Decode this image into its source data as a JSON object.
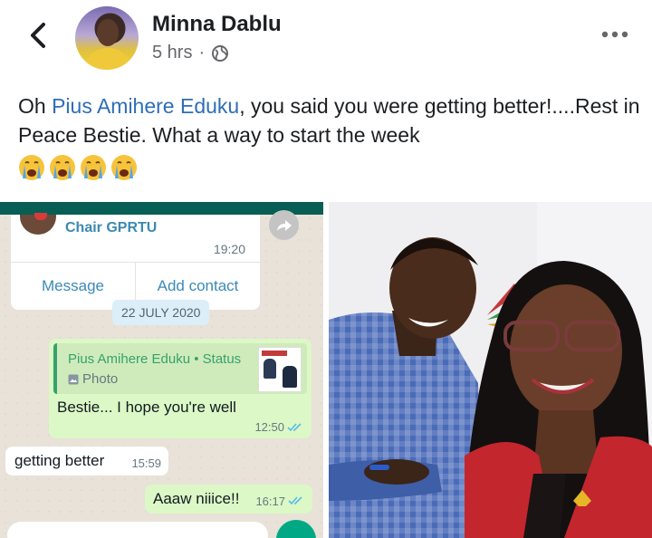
{
  "post": {
    "author": "Minna Dablu",
    "time": "5 hrs",
    "separator": "·",
    "caption_before": "Oh ",
    "mention": "Pius Amihere Eduku",
    "caption_after": ", you said you were getting better!....Rest in Peace Bestie. What a way to start the week",
    "emoji_count": 4,
    "emoji_name": "loudly-crying-face"
  },
  "chat": {
    "contact_name": "Chair GPRTU",
    "contact_time": "19:20",
    "message_button": "Message",
    "add_contact_button": "Add contact",
    "date": "22 JULY 2020",
    "messages": [
      {
        "quote_title": "Pius Amihere Eduku • Status",
        "quote_sub": "Photo",
        "text": "Bestie... I hope you're well",
        "time": "12:50"
      },
      {
        "text": "getting better",
        "time": "15:59"
      },
      {
        "text": "Aaaw niiice!!",
        "time": "16:17"
      }
    ]
  },
  "colors": {
    "mention": "#2f6eb5",
    "outgoing_bubble": "#dcf8c6",
    "incoming_bubble": "#ffffff",
    "whatsapp_header": "#075e54",
    "read_ticks": "#53bdeb",
    "status_accent": "#35a26c",
    "blazer_red": "#c4262e",
    "shirt_check_blue": "#4a6bb8"
  }
}
